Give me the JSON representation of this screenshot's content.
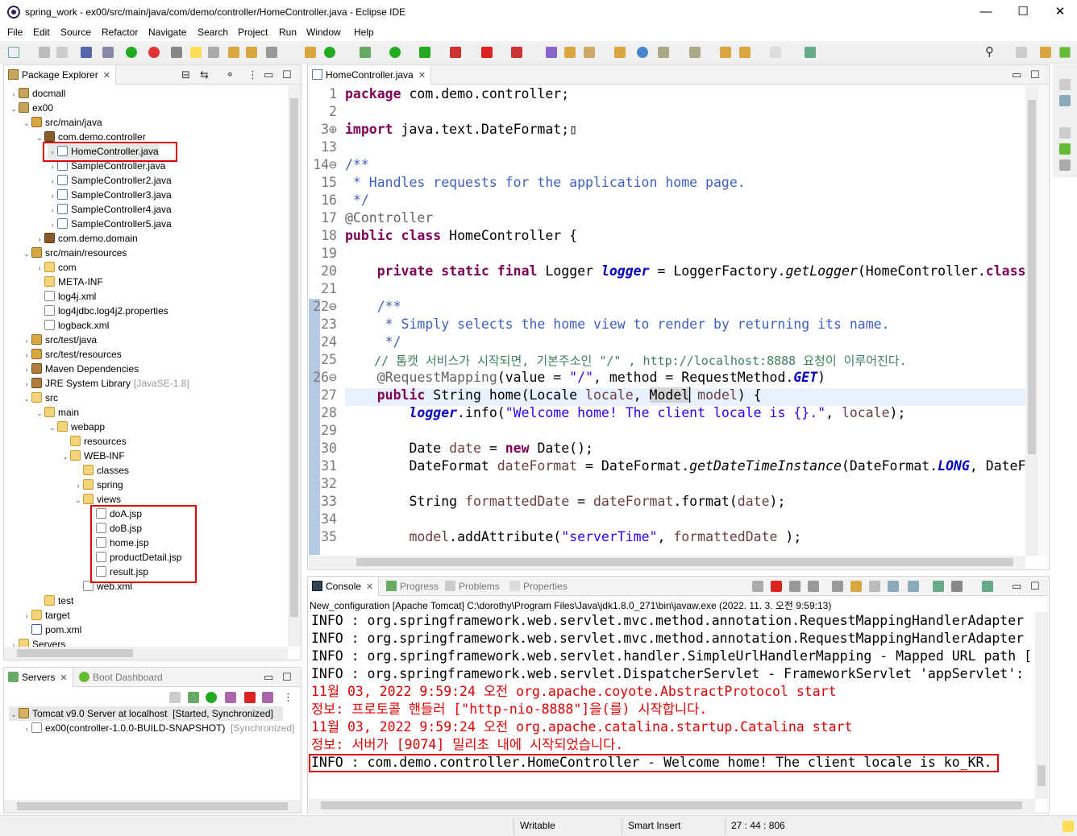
{
  "window": {
    "title": "spring_work - ex00/src/main/java/com/demo/controller/HomeController.java - Eclipse IDE",
    "minimize": "—",
    "maximize": "☐",
    "close": "✕"
  },
  "menu": [
    "File",
    "Edit",
    "Source",
    "Refactor",
    "Navigate",
    "Search",
    "Project",
    "Run",
    "Window",
    "Help"
  ],
  "package_explorer": {
    "tab_label": "Package Explorer",
    "rows": [
      {
        "label": "docmall",
        "icon": "project-icon",
        "depth": 0,
        "twisty": "›"
      },
      {
        "label": "ex00",
        "icon": "project-icon",
        "depth": 0,
        "twisty": "⌄"
      },
      {
        "label": "src/main/java",
        "icon": "source-folder-icon",
        "depth": 1,
        "twisty": "⌄"
      },
      {
        "label": "com.demo.controller",
        "icon": "package-icon",
        "depth": 2,
        "twisty": "⌄"
      },
      {
        "label": "HomeController.java",
        "icon": "java-file-icon",
        "depth": 3,
        "twisty": "›"
      },
      {
        "label": "SampleController.java",
        "icon": "java-file-icon",
        "depth": 3,
        "twisty": "›"
      },
      {
        "label": "SampleController2.java",
        "icon": "java-file-icon",
        "depth": 3,
        "twisty": "›"
      },
      {
        "label": "SampleController3.java",
        "icon": "java-file-icon",
        "depth": 3,
        "twisty": "›"
      },
      {
        "label": "SampleController4.java",
        "icon": "java-file-icon",
        "depth": 3,
        "twisty": "›"
      },
      {
        "label": "SampleController5.java",
        "icon": "java-file-icon",
        "depth": 3,
        "twisty": "›"
      },
      {
        "label": "com.demo.domain",
        "icon": "package-icon",
        "depth": 2,
        "twisty": "›"
      },
      {
        "label": "src/main/resources",
        "icon": "source-folder-icon",
        "depth": 1,
        "twisty": "⌄"
      },
      {
        "label": "com",
        "icon": "folder-icon",
        "depth": 2,
        "twisty": "›"
      },
      {
        "label": "META-INF",
        "icon": "folder-icon",
        "depth": 2,
        "twisty": ""
      },
      {
        "label": "log4j.xml",
        "icon": "xml-file-icon",
        "depth": 2,
        "twisty": ""
      },
      {
        "label": "log4jdbc.log4j2.properties",
        "icon": "file-icon",
        "depth": 2,
        "twisty": ""
      },
      {
        "label": "logback.xml",
        "icon": "xml-file-icon",
        "depth": 2,
        "twisty": ""
      },
      {
        "label": "src/test/java",
        "icon": "source-folder-icon",
        "depth": 1,
        "twisty": "›"
      },
      {
        "label": "src/test/resources",
        "icon": "source-folder-icon",
        "depth": 1,
        "twisty": "›"
      },
      {
        "label": "Maven Dependencies",
        "icon": "library-icon",
        "depth": 1,
        "twisty": "›"
      },
      {
        "label": "JRE System Library",
        "icon": "library-icon",
        "depth": 1,
        "twisty": "›",
        "decoration": "[JavaSE-1.8]"
      },
      {
        "label": "src",
        "icon": "folder-icon",
        "depth": 1,
        "twisty": "⌄"
      },
      {
        "label": "main",
        "icon": "folder-icon",
        "depth": 2,
        "twisty": "⌄"
      },
      {
        "label": "webapp",
        "icon": "folder-icon",
        "depth": 3,
        "twisty": "⌄"
      },
      {
        "label": "resources",
        "icon": "folder-icon",
        "depth": 4,
        "twisty": ""
      },
      {
        "label": "WEB-INF",
        "icon": "folder-icon",
        "depth": 4,
        "twisty": "⌄"
      },
      {
        "label": "classes",
        "icon": "folder-icon",
        "depth": 5,
        "twisty": ""
      },
      {
        "label": "spring",
        "icon": "folder-icon",
        "depth": 5,
        "twisty": "›"
      },
      {
        "label": "views",
        "icon": "folder-icon",
        "depth": 5,
        "twisty": "⌄"
      },
      {
        "label": "doA.jsp",
        "icon": "jsp-file-icon",
        "depth": 6,
        "twisty": ""
      },
      {
        "label": "doB.jsp",
        "icon": "jsp-file-icon",
        "depth": 6,
        "twisty": ""
      },
      {
        "label": "home.jsp",
        "icon": "jsp-file-icon",
        "depth": 6,
        "twisty": ""
      },
      {
        "label": "productDetail.jsp",
        "icon": "jsp-file-icon",
        "depth": 6,
        "twisty": ""
      },
      {
        "label": "result.jsp",
        "icon": "jsp-file-icon",
        "depth": 6,
        "twisty": ""
      },
      {
        "label": "web.xml",
        "icon": "xml-file-icon",
        "depth": 5,
        "twisty": ""
      },
      {
        "label": "test",
        "icon": "folder-icon",
        "depth": 2,
        "twisty": ""
      },
      {
        "label": "target",
        "icon": "folder-icon",
        "depth": 1,
        "twisty": "›"
      },
      {
        "label": "pom.xml",
        "icon": "pom-file-icon",
        "depth": 1,
        "twisty": ""
      },
      {
        "label": "Servers",
        "icon": "folder-icon",
        "depth": 0,
        "twisty": "›"
      }
    ]
  },
  "servers": {
    "tab_label": "Servers",
    "boot_tab_label": "Boot Dashboard",
    "server_label": "Tomcat v9.0 Server at localhost",
    "server_state": "[Started, Synchronized]",
    "module_label": "ex00(controller-1.0.0-BUILD-SNAPSHOT)",
    "module_state": "[Synchronized]"
  },
  "editor": {
    "tab_label": "HomeController.java"
  },
  "console": {
    "tab_label": "Console",
    "other_tabs": [
      "Progress",
      "Problems",
      "Properties"
    ],
    "launch_info": "New_configuration [Apache Tomcat] C:\\dorothy\\Program Files\\Java\\jdk1.8.0_271\\bin\\javaw.exe  (2022. 11. 3. 오전 9:59:13)",
    "lines": [
      {
        "text": "INFO : org.springframework.web.servlet.mvc.method.annotation.RequestMappingHandlerAdapter",
        "color": "black"
      },
      {
        "text": "INFO : org.springframework.web.servlet.mvc.method.annotation.RequestMappingHandlerAdapter",
        "color": "black"
      },
      {
        "text": "INFO : org.springframework.web.servlet.handler.SimpleUrlHandlerMapping - Mapped URL path [",
        "color": "black"
      },
      {
        "text": "INFO : org.springframework.web.servlet.DispatcherServlet - FrameworkServlet 'appServlet':",
        "color": "black"
      },
      {
        "text": "11월 03, 2022 9:59:24 오전 org.apache.coyote.AbstractProtocol start",
        "color": "red"
      },
      {
        "text": "정보: 프로토콜 핸들러 [\"http-nio-8888\"]을(를) 시작합니다.",
        "color": "red"
      },
      {
        "text": "11월 03, 2022 9:59:24 오전 org.apache.catalina.startup.Catalina start",
        "color": "red"
      },
      {
        "text": "정보: 서버가 [9074] 밀리초 내에 시작되었습니다.",
        "color": "red"
      },
      {
        "text": "INFO : com.demo.controller.HomeController - Welcome home! The client locale is ko_KR.",
        "color": "black"
      }
    ]
  },
  "status": {
    "mode": "Writable",
    "insert": "Smart Insert",
    "position": "27 : 44 : 806"
  }
}
